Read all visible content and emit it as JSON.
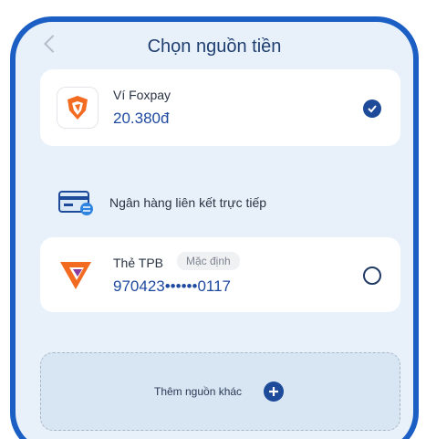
{
  "header": {
    "title": "Chọn nguồn tiền"
  },
  "wallet": {
    "name": "Ví Foxpay",
    "balance": "20.380đ"
  },
  "section": {
    "label": "Ngân hàng liên kết trực tiếp"
  },
  "bank": {
    "name": "Thẻ TPB",
    "badge": "Mặc định",
    "number": "970423••••••0117"
  },
  "add_source": {
    "label": "Thêm nguồn khác"
  },
  "colors": {
    "frame": "#1b5fc4",
    "accent": "#1e4a9a",
    "background": "#e8f1fa",
    "tpb_orange": "#f26b21"
  },
  "icons": [
    "back-icon",
    "foxpay-logo-icon",
    "check-icon",
    "bank-card-icon",
    "tpbank-logo-icon",
    "radio-icon",
    "plus-icon"
  ]
}
